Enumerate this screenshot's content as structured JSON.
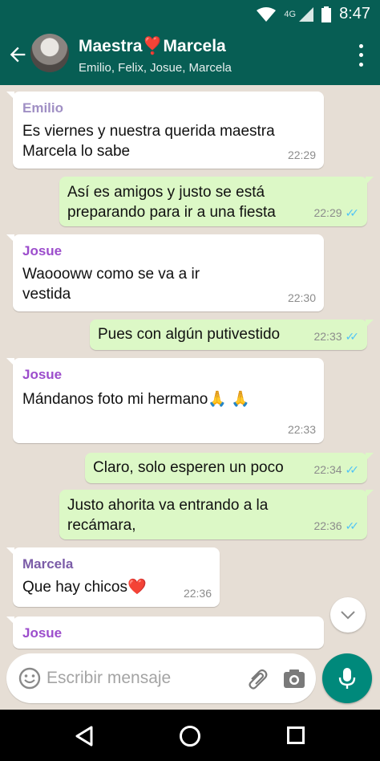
{
  "status_bar": {
    "network": "4G",
    "time": "8:47"
  },
  "header": {
    "title": "Maestra❣️Marcela",
    "members": "Emilio, Felix, Josue, Marcela"
  },
  "messages": [
    {
      "direction": "in",
      "sender": "Emilio",
      "sender_color": "#a08fc4",
      "text": "Es viernes y nuestra querida maestra Marcela lo sabe",
      "time": "22:29"
    },
    {
      "direction": "out",
      "text": "Así es amigos y justo se está preparando para ir a una fiesta",
      "time": "22:29",
      "status": "read"
    },
    {
      "direction": "in",
      "sender": "Josue",
      "sender_color": "#9c4dcc",
      "text": "Waoooww como se va a ir vestida",
      "time": "22:30"
    },
    {
      "direction": "out",
      "text": "Pues con algún putivestido",
      "time": "22:33",
      "status": "read"
    },
    {
      "direction": "in",
      "sender": "Josue",
      "sender_color": "#9c4dcc",
      "text": "Mándanos foto mi hermano🙏 🙏",
      "time": "22:33"
    },
    {
      "direction": "out",
      "text": "Claro, solo esperen un poco",
      "time": "22:34",
      "status": "read"
    },
    {
      "direction": "out",
      "text": "Justo ahorita va entrando a la recámara,",
      "time": "22:36",
      "status": "read"
    },
    {
      "direction": "in",
      "sender": "Marcela",
      "sender_color": "#7b5ca8",
      "text": "Que hay chicos❤️",
      "time": "22:36"
    },
    {
      "direction": "in",
      "sender": "Josue",
      "sender_color": "#9c4dcc",
      "text": "",
      "time": ""
    }
  ],
  "composer": {
    "placeholder": "Escribir mensaje"
  },
  "colors": {
    "header": "#075e54",
    "outgoing": "#dcf8c6",
    "incoming": "#ffffff",
    "accent": "#00897b",
    "read_tick": "#4fc3f7"
  },
  "icons": [
    "back-arrow-icon",
    "more-vert-icon",
    "emoji-icon",
    "attach-icon",
    "camera-icon",
    "mic-icon",
    "chevron-down-icon",
    "nav-back-icon",
    "nav-home-icon",
    "nav-recents-icon"
  ]
}
